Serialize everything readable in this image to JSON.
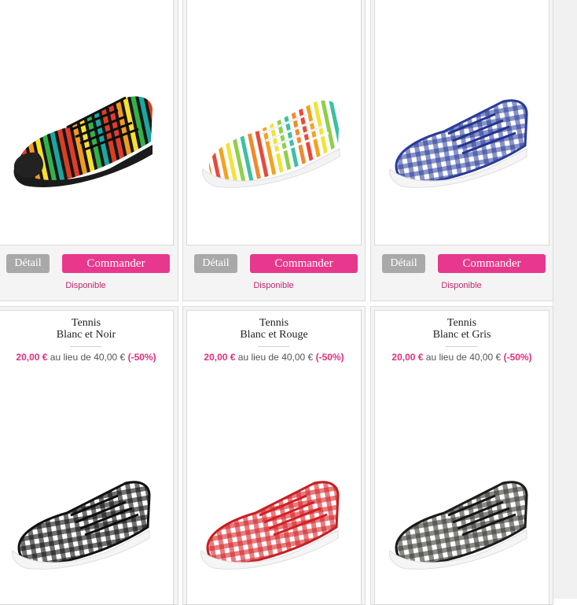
{
  "colors": {
    "accent": "#e8388d",
    "detail_button": "#a9a9a9",
    "available": "#c2256e"
  },
  "top_row": [
    {
      "detail_label": "Détail",
      "order_label": "Commander",
      "availability": "Disponible",
      "shoe": "rainbow-stripe-sneaker"
    },
    {
      "detail_label": "Détail",
      "order_label": "Commander",
      "availability": "Disponible",
      "shoe": "pastel-stripe-sneaker"
    },
    {
      "detail_label": "Détail",
      "order_label": "Commander",
      "availability": "Disponible",
      "shoe": "blue-gingham-sneaker"
    }
  ],
  "products": [
    {
      "name": "Tennis",
      "variant": "Blanc et Noir",
      "price": "20,00 €",
      "instead_label": "au lieu de",
      "old_price": "40,00 €",
      "discount": "(-50%)",
      "shoe": "black-gingham-sneaker"
    },
    {
      "name": "Tennis",
      "variant": "Blanc et Rouge",
      "price": "20,00 €",
      "instead_label": "au lieu de",
      "old_price": "40,00 €",
      "discount": "(-50%)",
      "shoe": "red-gingham-sneaker"
    },
    {
      "name": "Tennis",
      "variant": "Blanc et Gris",
      "price": "20,00 €",
      "instead_label": "au lieu de",
      "old_price": "40,00 €",
      "discount": "(-50%)",
      "shoe": "gray-gingham-sneaker"
    }
  ]
}
